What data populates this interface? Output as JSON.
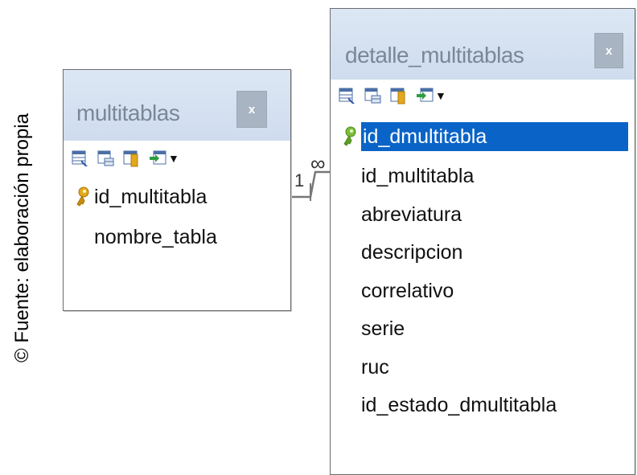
{
  "caption": "© Fuente: elaboración propia",
  "tables": {
    "multitablas": {
      "title": "multitablas",
      "close": "x",
      "columns": [
        {
          "name": "id_multitabla",
          "key": true
        },
        {
          "name": "nombre_tabla",
          "key": false
        }
      ]
    },
    "detalle": {
      "title": "detalle_multitablas",
      "close": "x",
      "columns": [
        {
          "name": "id_dmultitabla",
          "key": true,
          "selected": true
        },
        {
          "name": "id_multitabla",
          "key": false
        },
        {
          "name": "abreviatura",
          "key": false
        },
        {
          "name": "descripcion",
          "key": false
        },
        {
          "name": "correlativo",
          "key": false
        },
        {
          "name": "serie",
          "key": false
        },
        {
          "name": "ruc",
          "key": false
        },
        {
          "name": "id_estado_dmultitabla",
          "key": false
        }
      ]
    }
  },
  "relationship": {
    "one_label": "1",
    "many_symbol": "∞"
  },
  "colors": {
    "header_bg": "#d6e2f1",
    "selected_bg": "#0a64c8",
    "title_text": "#7a8797",
    "close_bg": "#a8b4c2",
    "key_gold": "#e2a91e"
  },
  "icons": [
    "table-view-icon",
    "grid-icon",
    "key-table-icon",
    "import-icon",
    "dropdown-arrow-icon",
    "primary-key-icon",
    "close-icon"
  ]
}
